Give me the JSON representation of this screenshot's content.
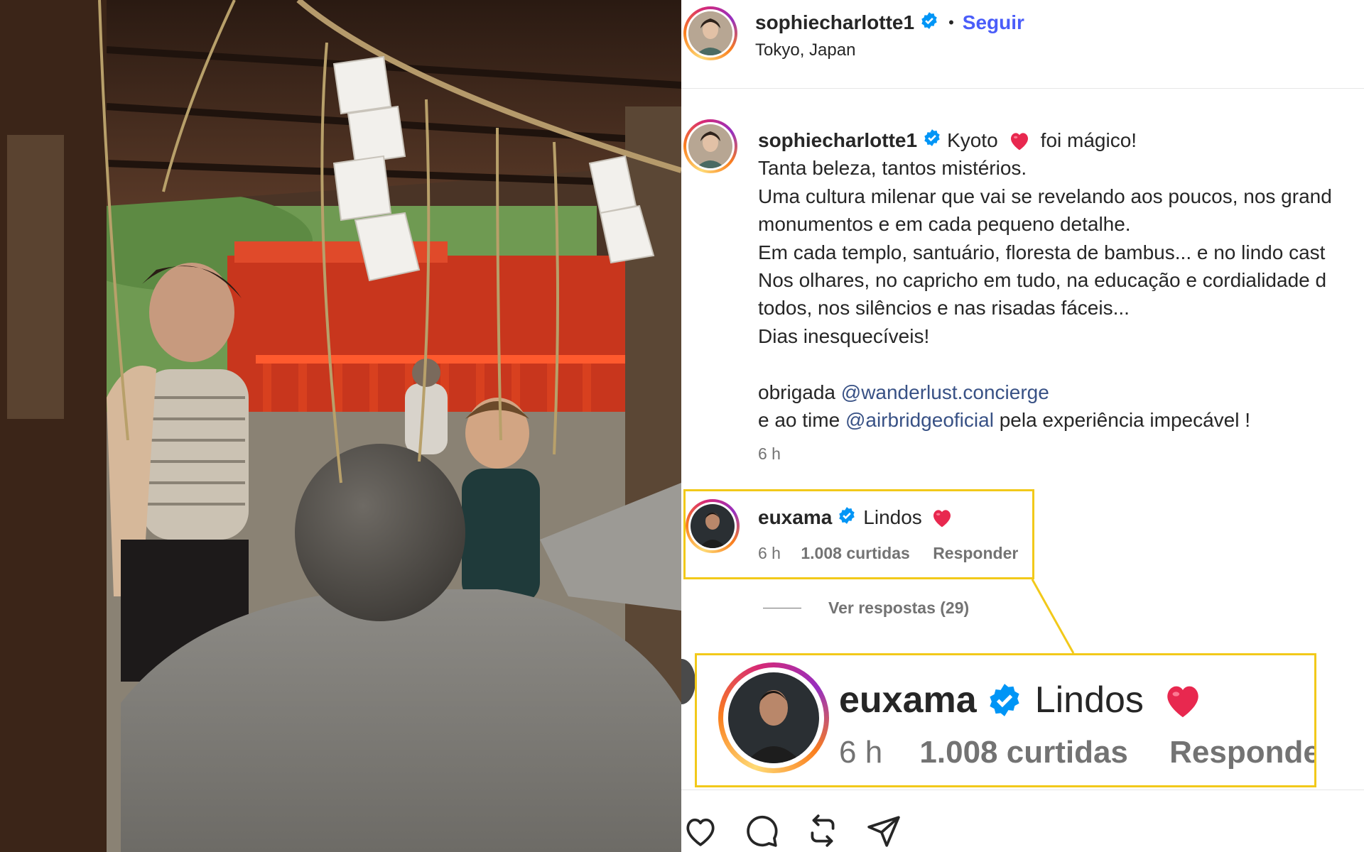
{
  "header": {
    "username": "sophiecharlotte1",
    "separator": "•",
    "follow_label": "Seguir",
    "location": "Tokyo, Japan"
  },
  "caption": {
    "username": "sophiecharlotte1",
    "lines": [
      "Kyoto",
      "foi mágico!",
      "Tanta beleza, tantos mistérios.",
      "Uma cultura milenar que vai se revelando aos poucos, nos grand",
      "monumentos e em cada pequeno detalhe.",
      "Em cada templo, santuário, floresta de bambus... e no lindo cast",
      "Nos olhares, no capricho em tudo, na educação e cordialidade d",
      "todos, nos silêncios e nas risadas fáceis...",
      "Dias inesquecíveis!"
    ],
    "thanks_prefix": "obrigada",
    "mention_1": "@wanderlust.concierge",
    "team_prefix": "e ao time",
    "mention_2": "@airbridgeoficial",
    "team_suffix": "pela experiência impecável !",
    "time": "6 h"
  },
  "comment": {
    "username": "euxama",
    "text": "Lindos",
    "time": "6 h",
    "likes": "1.008 curtidas",
    "reply_label": "Responder",
    "view_replies": "Ver respostas (29)"
  },
  "zoom": {
    "username": "euxama",
    "text": "Lindos",
    "time": "6 h",
    "likes": "1.008 curtidas",
    "reply_label": "Responde"
  },
  "icons": {
    "heart": "heart-icon",
    "comment": "comment-icon",
    "repost": "repost-icon",
    "share": "share-icon",
    "verified": "verified-badge-icon",
    "emoji_heart": "red-heart-emoji-icon"
  },
  "colors": {
    "link": "#385185",
    "follow": "#4a5df9",
    "highlight": "#f2c91a",
    "heart_emoji": "#e8284f",
    "verified": "#0095f6"
  }
}
